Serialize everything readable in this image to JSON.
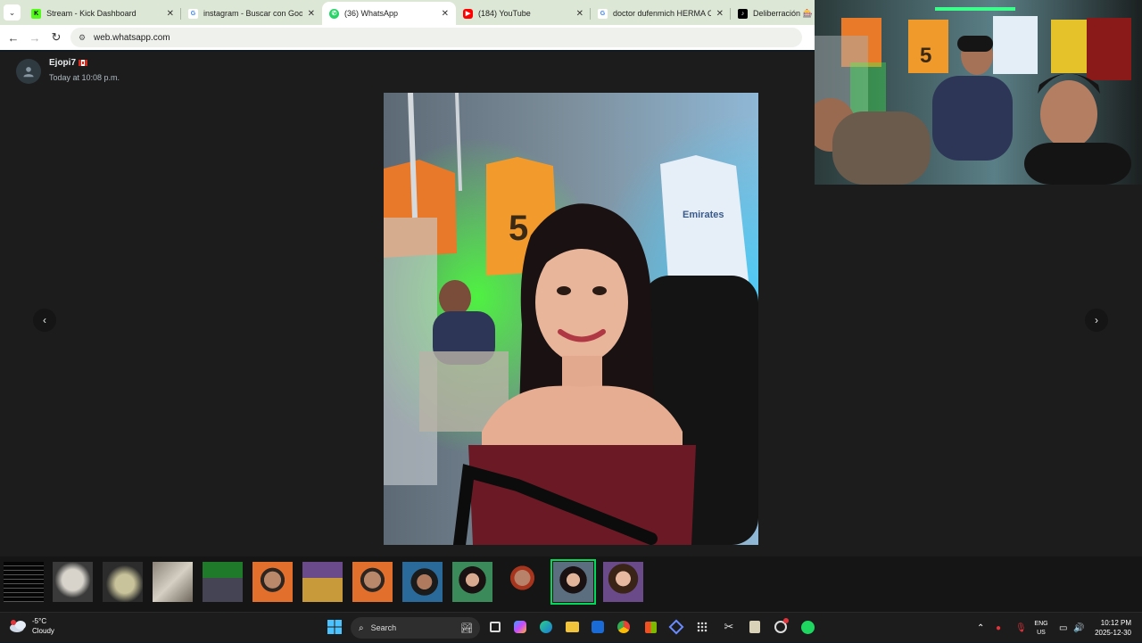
{
  "browser": {
    "tabs": [
      {
        "title": "Stream - Kick Dashboard",
        "favicon": "kick-icon",
        "color": "#53fc18",
        "active": false
      },
      {
        "title": "instagram - Buscar con Google",
        "favicon": "google-icon",
        "color": "#4285f4",
        "active": false
      },
      {
        "title": "(36) WhatsApp",
        "favicon": "whatsapp-icon",
        "color": "#25d366",
        "active": true
      },
      {
        "title": "(184) YouTube",
        "favicon": "youtube-icon",
        "color": "#ff0000",
        "active": false
      },
      {
        "title": "doctor dufenmich HERMA O - G",
        "favicon": "google-icon",
        "color": "#4285f4",
        "active": false
      },
      {
        "title": "Deliberración 🎰 🔪",
        "favicon": "tiktok-icon",
        "color": "#000000",
        "active": false
      }
    ],
    "close_glyph": "✕",
    "url": "web.whatsapp.com"
  },
  "viewer": {
    "sender_name": "Ejopi7",
    "sender_time": "Today at 10:08 p.m.",
    "prev_glyph": "‹",
    "next_glyph": "›",
    "thumbnail_count": 13,
    "selected_thumbnail": 11
  },
  "taskbar": {
    "weather_temp": "-5°C",
    "weather_desc": "Cloudy",
    "search_label": "Search",
    "lang_top": "ENG",
    "lang_bottom": "US",
    "time": "10:12 PM",
    "date": "2025-12-30",
    "accent": "#0078d4"
  }
}
